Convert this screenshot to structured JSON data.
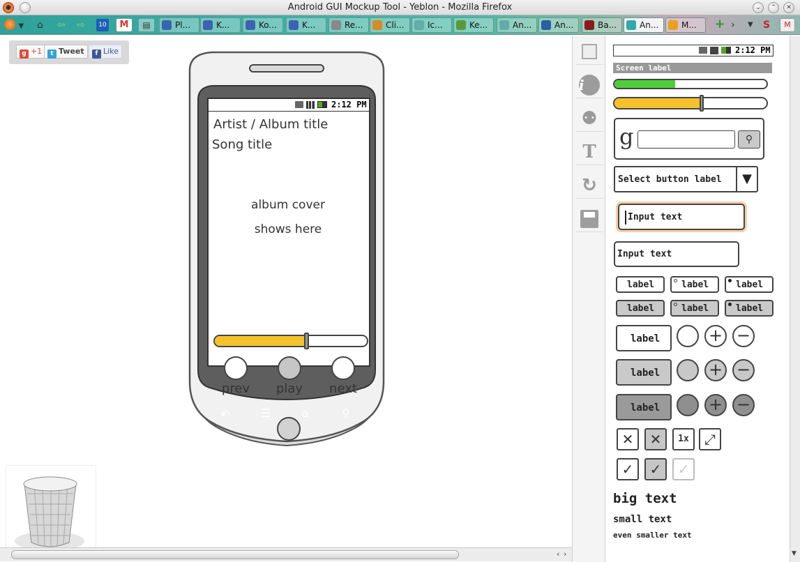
{
  "window": {
    "title": "Android GUI Mockup Tool - Yeblon - Mozilla Firefox"
  },
  "tabs": [
    {
      "label": "Pl...",
      "icon": "kde-icon"
    },
    {
      "label": "K...",
      "icon": "kde-icon"
    },
    {
      "label": "Ko...",
      "icon": "kde-icon"
    },
    {
      "label": "K...",
      "icon": "kde-icon"
    },
    {
      "label": "Re...",
      "icon": "page-icon"
    },
    {
      "label": "Cli...",
      "icon": "clip-icon"
    },
    {
      "label": "Ic...",
      "icon": "globe-icon"
    },
    {
      "label": "Ke...",
      "icon": "key-icon"
    },
    {
      "label": "An...",
      "icon": "globe-icon"
    },
    {
      "label": "An...",
      "icon": "bo-icon"
    },
    {
      "label": "Ba...",
      "icon": "b-icon"
    },
    {
      "label": "An...",
      "icon": "android-icon"
    },
    {
      "label": "M...",
      "icon": "compass-icon"
    }
  ],
  "toolbar": {
    "calendar_badge": "10"
  },
  "social": {
    "plus_one": "+1",
    "tweet": "Tweet",
    "like": "Like"
  },
  "phone": {
    "status_time": "2:12 PM",
    "artist_line": "Artist / Album title",
    "song_line": "Song title",
    "cover_line1": "album cover",
    "cover_line2": "shows here",
    "progress": 0.6,
    "buttons": [
      "prev",
      "play",
      "next"
    ]
  },
  "palette": {
    "status_time": "2:12 PM",
    "screen_label": "Screen label",
    "progress_green": 0.4,
    "progress_orange": 0.57,
    "search_logo": "g",
    "select_label": "Select button label",
    "input_focused": "Input text",
    "input_plain": "Input text",
    "small_label": "label",
    "big_label": "label",
    "onex": "1x",
    "big_text": "big text",
    "small_text": "small text",
    "smaller_text": "even smaller text"
  },
  "colors": {
    "accent_orange": "#f5c22b",
    "accent_green": "#4fcc3a",
    "tab_teal": "#3bb0a6"
  }
}
